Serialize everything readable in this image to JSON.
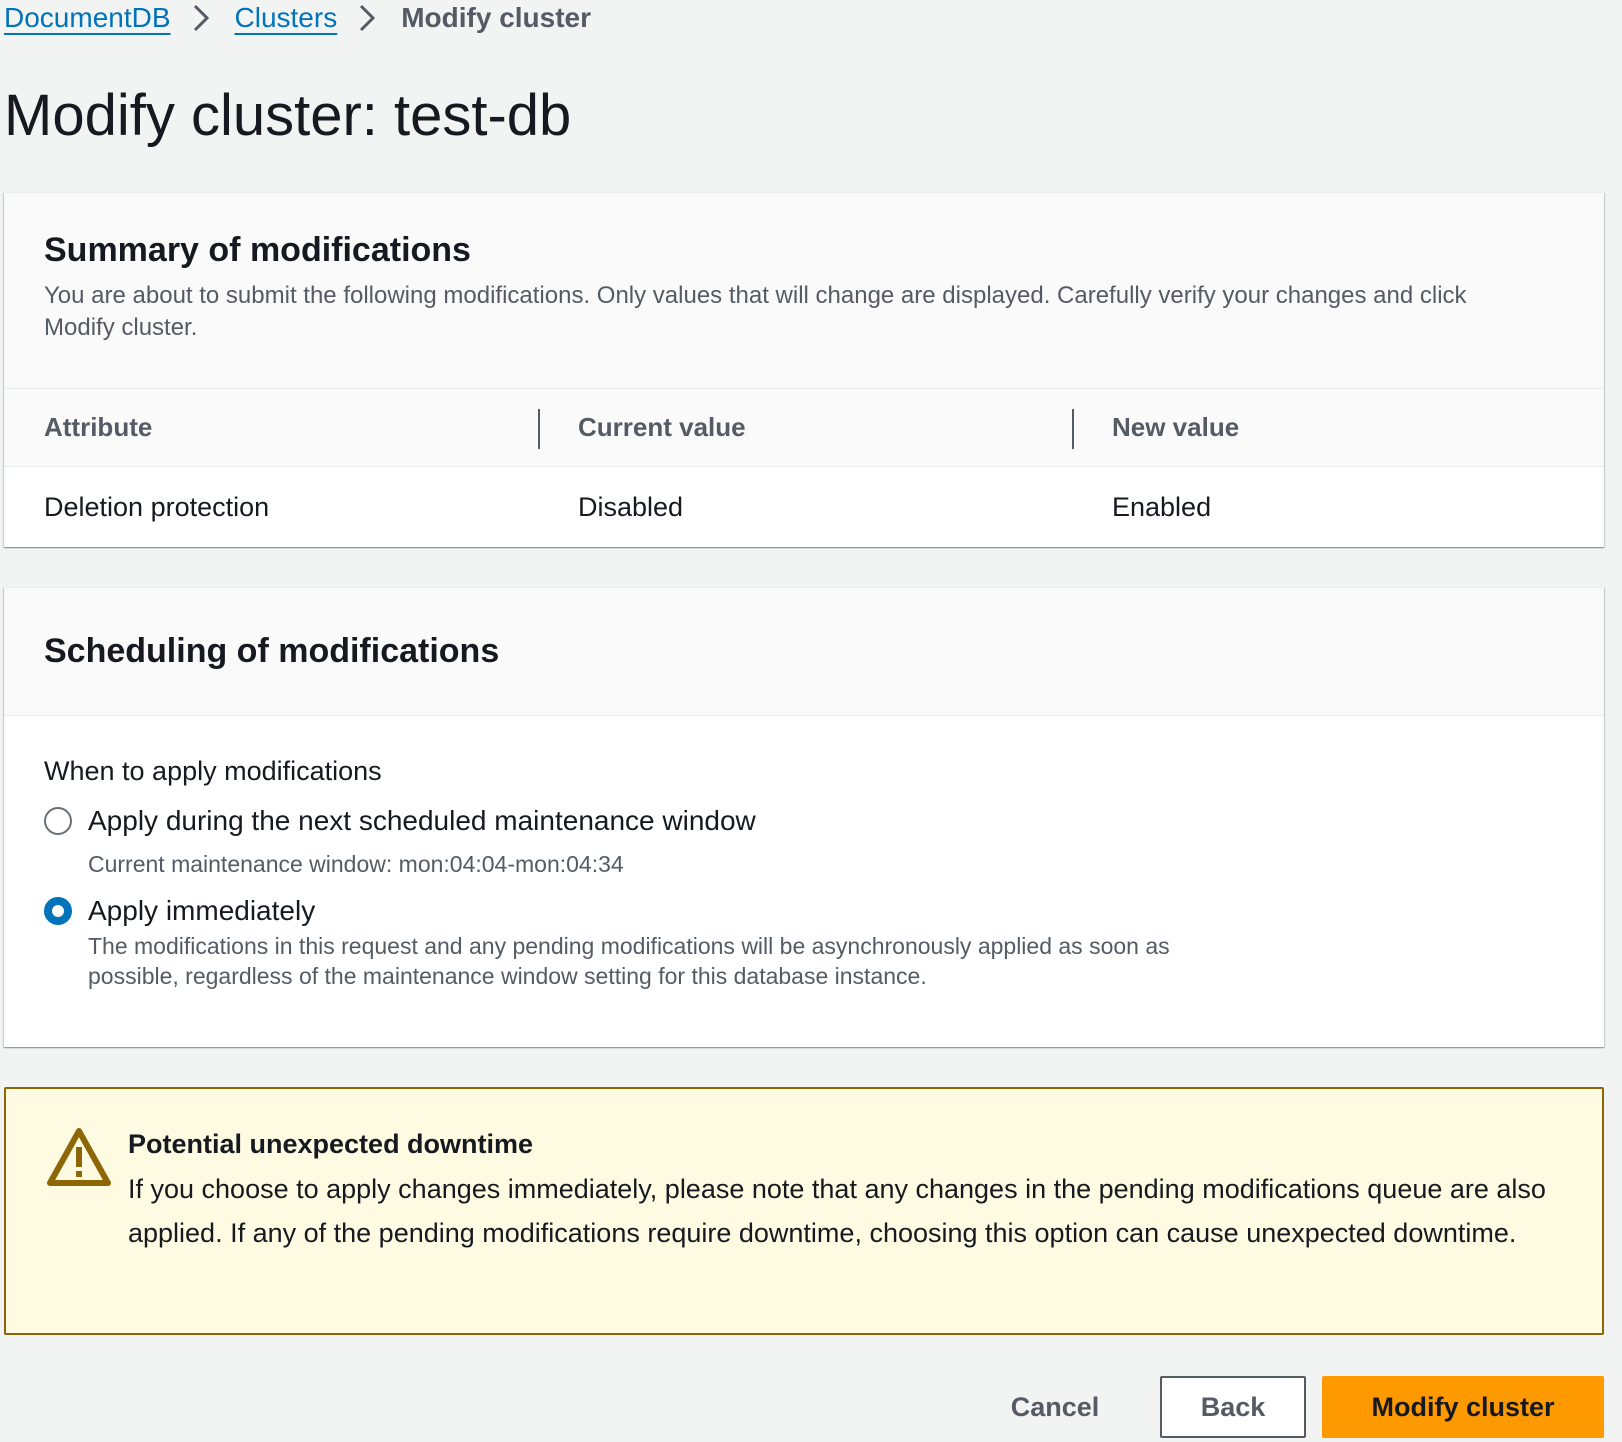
{
  "breadcrumb": {
    "items": [
      "DocumentDB",
      "Clusters"
    ],
    "current": "Modify cluster"
  },
  "page_title": "Modify cluster: test-db",
  "summary": {
    "title": "Summary of modifications",
    "description": "You are about to submit the following modifications. Only values that will change are displayed. Carefully verify your changes and click Modify cluster.",
    "columns": [
      "Attribute",
      "Current value",
      "New value"
    ],
    "rows": [
      [
        "Deletion protection",
        "Disabled",
        "Enabled"
      ]
    ]
  },
  "scheduling": {
    "title": "Scheduling of modifications",
    "field_label": "When to apply modifications",
    "options": [
      {
        "label": "Apply during the next scheduled maintenance window",
        "description": "Current maintenance window: mon:04:04-mon:04:34",
        "checked": false
      },
      {
        "label": "Apply immediately",
        "description": "The modifications in this request and any pending modifications will be asynchronously applied as soon as possible, regardless of the maintenance window setting for this database instance.",
        "checked": true
      }
    ]
  },
  "alert": {
    "icon": "warning-icon",
    "title": "Potential unexpected downtime",
    "text": "If you choose to apply changes immediately, please note that any changes in the pending modifications queue are also applied. If any of the pending modifications require downtime, choosing this option can cause unexpected downtime."
  },
  "actions": {
    "cancel_label": "Cancel",
    "back_label": "Back",
    "primary_label": "Modify cluster"
  },
  "colors": {
    "link": "#0073bb",
    "primary": "#ff9900",
    "warning_bg": "#fefbe2",
    "warning_border": "#8d6605",
    "radio_selected": "#0073bb"
  }
}
